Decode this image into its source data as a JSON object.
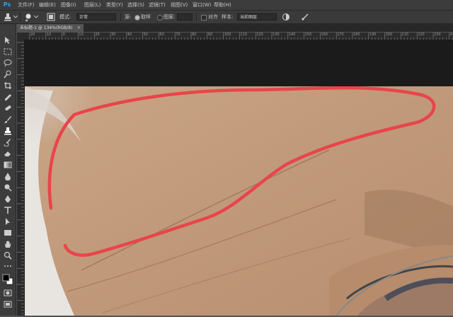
{
  "app": {
    "logo": "Ps"
  },
  "menubar": {
    "items": [
      "文件(F)",
      "编辑(E)",
      "图像(I)",
      "图层(L)",
      "类型(Y)",
      "选择(S)",
      "滤镜(T)",
      "视图(V)",
      "窗口(W)",
      "帮助(H)",
      ""
    ]
  },
  "options": {
    "mode_label": "模式:",
    "mode_value": "正常",
    "source_label": "源:",
    "source_sampled": "取样",
    "source_pattern": "图案:",
    "aligned_label": "对齐",
    "sample_label": "样本:",
    "sample_value": "当前图层"
  },
  "document": {
    "tab_label": "未标题-1 @ 134%(RGB/8)",
    "close_glyph": "×"
  },
  "ruler": {
    "labels": [
      "20",
      "10",
      "0",
      "10",
      "20",
      "30",
      "40",
      "50",
      "60",
      "70",
      "80",
      "90",
      "100",
      "110",
      "120",
      "130",
      "140",
      "150",
      "160",
      "170",
      "180",
      "190",
      "200",
      "210",
      "220",
      "230",
      "240"
    ]
  },
  "annotation": {
    "color": "#e8454a"
  }
}
